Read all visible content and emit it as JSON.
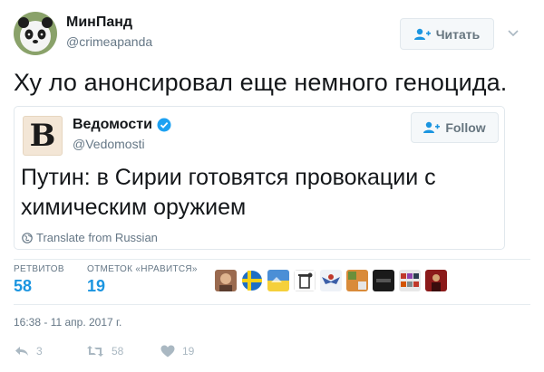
{
  "author": {
    "name": "МинПанд",
    "handle": "@crimeapanda"
  },
  "follow_button": {
    "label": "Читать"
  },
  "tweet": {
    "text": "Ху  ло анонсировал еще немного геноцида."
  },
  "quoted_tweet": {
    "logo_letter": "B",
    "name": "Ведомости",
    "handle": "@Vedomosti",
    "follow_label": "Follow",
    "text": "Путин: в Сирии готовятся провокации с химическим оружием",
    "translate_label": "Translate from Russian"
  },
  "stats": {
    "retweets_label": "РЕТВИТОВ",
    "retweets_value": "58",
    "likes_label": "ОТМЕТОК «НРАВИТСЯ»",
    "likes_value": "19"
  },
  "timestamp": "16:38 - 11 апр. 2017 г.",
  "actions": {
    "reply_count": "3",
    "retweet_count": "58",
    "like_count": "19"
  },
  "colors": {
    "accent": "#1b95e0",
    "secondary_text": "#657786",
    "verified": "#1da1f2",
    "action_icon": "#aab8c2"
  }
}
